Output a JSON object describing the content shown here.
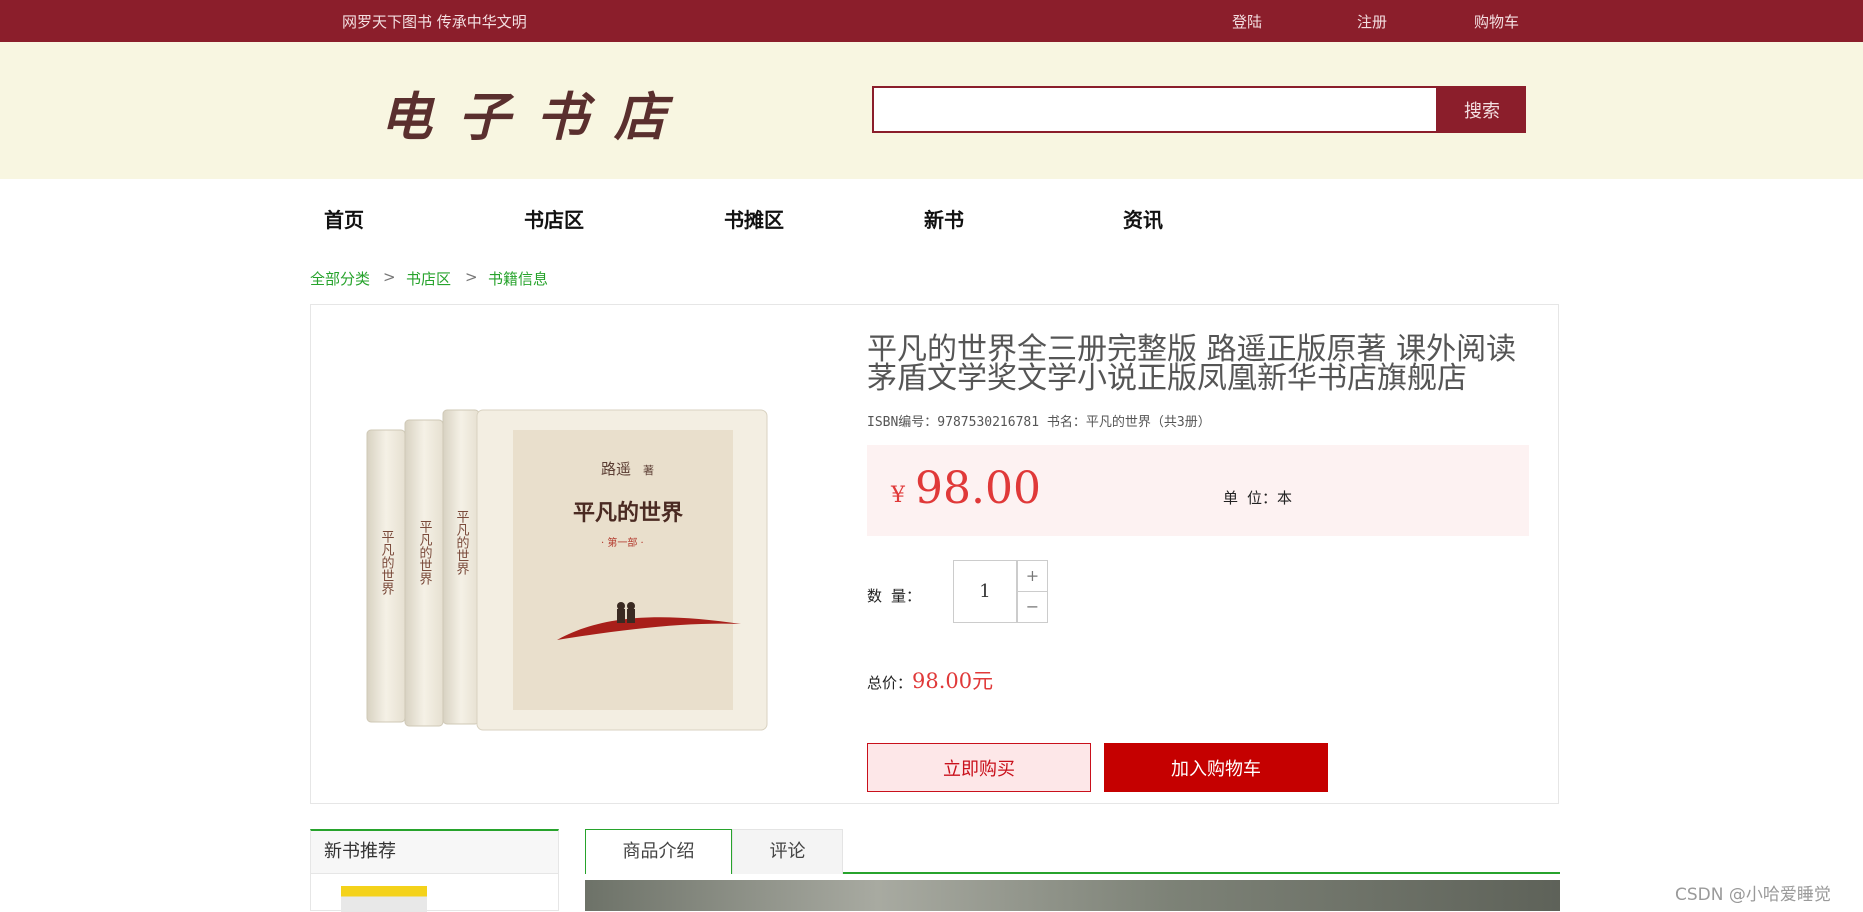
{
  "topbar": {
    "slogan": "网罗天下图书  传承中华文明",
    "login": "登陆",
    "register": "注册",
    "cart": "购物车"
  },
  "header": {
    "logo": "电子书店",
    "search_placeholder": "",
    "search_button": "搜索"
  },
  "nav": {
    "items": [
      "首页",
      "书店区",
      "书摊区",
      "新书",
      "资讯"
    ]
  },
  "breadcrumb": {
    "items": [
      "全部分类",
      "书店区",
      "书籍信息"
    ],
    "separator": ">"
  },
  "product": {
    "title": "平凡的世界全三册完整版 路遥正版原著 课外阅读茅盾文学奖文学小说正版凤凰新华书店旗舰店",
    "meta": "ISBN编号：9787530216781  书名：平凡的世界（共3册）",
    "currency": "¥",
    "price": "98.00",
    "unit": "单 位：本",
    "quantity_label": "数 量：",
    "quantity": "1",
    "plus": "+",
    "minus": "−",
    "total_label": "总价：",
    "total_value": "98.00元",
    "buy_now": "立即购买",
    "add_cart": "加入购物车",
    "cover": {
      "author": "路遥",
      "author_suffix": "著",
      "title": "平凡的世界",
      "volume": "· 第一部 ·",
      "spine": "平凡的世界"
    }
  },
  "sidebar": {
    "title": "新书推荐"
  },
  "tabs": [
    "商品介绍",
    "评论"
  ],
  "watermark": "CSDN @小哈爱睡觉",
  "colors": {
    "brand": "#8b1e2b",
    "header_bg": "#f8f6e1",
    "accent_green": "#27a32c",
    "price_red": "#e03939",
    "cart_red": "#c50000"
  }
}
